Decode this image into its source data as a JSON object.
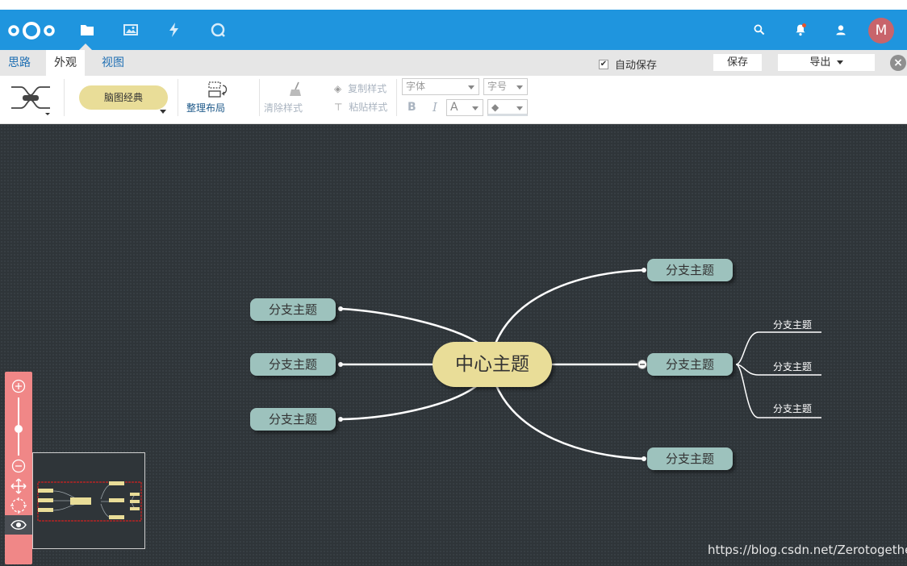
{
  "header": {
    "apps": [
      {
        "icon": "folder-icon",
        "name": "Files"
      },
      {
        "icon": "image-icon",
        "name": "Gallery"
      },
      {
        "icon": "lightning-icon",
        "name": "Activity"
      },
      {
        "icon": "talk-icon",
        "name": "Talk"
      }
    ],
    "avatar_letter": "M",
    "accent_color": "#1f95de"
  },
  "tabs": [
    {
      "label": "思路"
    },
    {
      "label": "外观"
    },
    {
      "label": "视图"
    }
  ],
  "active_tab": "外观",
  "autosave": {
    "label": "自动保存",
    "checked": true,
    "check_mark": "✔"
  },
  "save_label": "保存",
  "export_label": "导出",
  "toolbar": {
    "theme_label": "脑图经典",
    "layout_label": "整理布局",
    "clear_style_label": "清除样式",
    "copy_style_label": "复制样式",
    "paste_style_label": "粘贴样式",
    "font_placeholder": "字体",
    "size_placeholder": "字号",
    "bold_label": "B",
    "italic_label": "I",
    "font_color_label": "A"
  },
  "mindmap": {
    "center": "中心主题",
    "left_branches": [
      "分支主题",
      "分支主题",
      "分支主题"
    ],
    "right_branches": [
      "分支主题",
      "分支主题",
      "分支主题"
    ],
    "sub_branches": [
      "分支主题",
      "分支主题",
      "分支主题"
    ]
  },
  "watermark": "https://blog.csdn.net/Zerotogether"
}
